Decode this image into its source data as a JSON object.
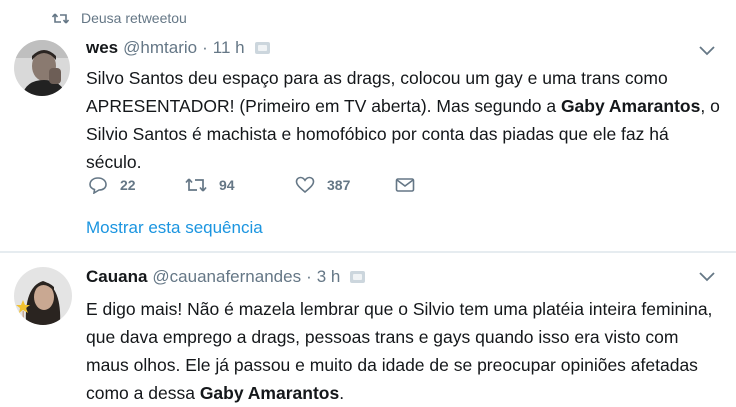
{
  "retweet_context": {
    "text": "Deusa retweetou"
  },
  "tweets": [
    {
      "name": "wes",
      "handle": "@hmtario",
      "separator": "·",
      "time": "11 h",
      "text_parts": [
        "Silvo Santos deu espaço para as drags, colocou um gay e uma trans como APRESENTADOR! (Primeiro em TV aberta). Mas segundo a ",
        "Gaby Amarantos",
        ", o Silvio Santos é machista e homofóbico por conta das piadas que ele faz há século."
      ],
      "replies": "22",
      "retweets": "94",
      "likes": "387",
      "thread_link": "Mostrar esta sequência"
    },
    {
      "name": "Cauana",
      "handle": "@cauanafernandes",
      "separator": "·",
      "time": "3 h",
      "text_parts": [
        "E digo mais! Não é mazela lembrar que o Silvio tem uma platéia inteira feminina, que dava emprego a drags, pessoas trans e gays quando isso era visto com maus olhos. Ele já passou e muito da idade de se preocupar opiniões afetadas como a dessa ",
        "Gaby Amarantos",
        "."
      ]
    }
  ],
  "colors": {
    "text": "#14171a",
    "muted": "#657786",
    "link": "#1b95e0",
    "divider": "#e6ecf0"
  },
  "icons": [
    "retweet-icon",
    "reply-icon",
    "like-icon",
    "message-icon",
    "chevron-down-icon",
    "verified-pill-icon"
  ]
}
